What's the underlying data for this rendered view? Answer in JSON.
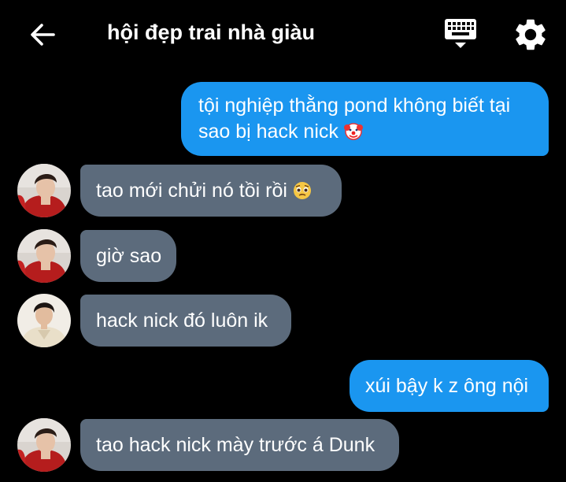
{
  "header": {
    "title": "hội đẹp trai nhà giàu",
    "back_icon": "arrow-left-icon",
    "keyboard_icon": "keyboard-icon",
    "settings_icon": "gear-icon"
  },
  "messages": [
    {
      "direction": "out",
      "text_line1": "tội nghiệp thằng pond không biết tại",
      "text_line2": "sao bị hack nick",
      "emoji": "clown-face-emoji"
    },
    {
      "direction": "in",
      "text": "tao mới chửi nó tồi rồi",
      "emoji": "pleading-face-emoji",
      "avatar": "avatar-red-shirt"
    },
    {
      "direction": "in",
      "text": "giờ sao",
      "avatar": "avatar-red-shirt"
    },
    {
      "direction": "in",
      "text": "hack nick đó luôn ik",
      "avatar": "avatar-cream-sweater"
    },
    {
      "direction": "out",
      "text": "xúi bậy k z ông nội"
    },
    {
      "direction": "in",
      "text": "tao hack nick mày trước á Dunk",
      "avatar": "avatar-red-shirt"
    }
  ],
  "colors": {
    "background": "#000000",
    "outgoing_bubble": "#1a96f0",
    "incoming_bubble": "#5c6b7c",
    "text": "#ffffff"
  }
}
